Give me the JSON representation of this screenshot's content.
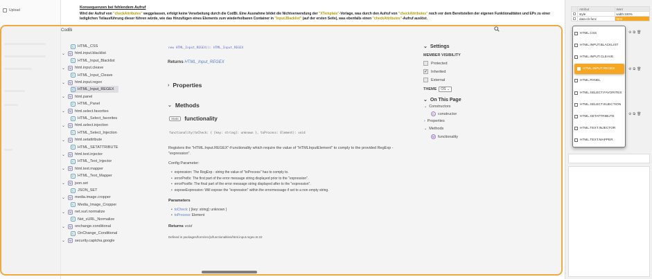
{
  "left_panel": {
    "upload_label": "Upload"
  },
  "doc": {
    "heading": "Konsequenzen bei fehlendem Aufruf",
    "para_1": "Wird der Aufruf von ",
    "para_hl_1": "\"checkAttributes\"",
    "para_2": " weggelassen, erfolgt keine Verarbeitung durch die CodBi. Eine Ausnahme bildet die Nichtverwendung der ",
    "para_hl_2": "\"XTemplate\"",
    "para_3": "-Vorlage, was durch den Aufruf von ",
    "para_hl_3": "\"checkAttributes\"",
    "para_4": " noch vor dem Bereitstellen der eigenen Funktionalitäten und EPs zu einer lediglichen Teilausführung dieser führen würde, wie das Hinzufügen eines Elements zum wiederholbaren Container in ",
    "para_hl_4": "\"Input.Blacklist\"",
    "para_5": " (auf der ersten Seite), was ebenfalls einen ",
    "para_hl_5": "\"checkAttributes\"",
    "para_6": "-Aufruf auslöst."
  },
  "attr_table": {
    "header": [
      "Attribut",
      "Wert"
    ],
    "rows": [
      {
        "name": "style",
        "value": "width:100%"
      },
      {
        "name": "data-cb-func",
        "value": "html"
      }
    ]
  },
  "modal": {
    "title": "CodBi",
    "tree": [
      {
        "label": "HTML_CSS",
        "kind": "class",
        "child": true,
        "top": 0
      },
      {
        "label": "html.input.blacklist",
        "kind": "module",
        "child": false
      },
      {
        "label": "HTML_Input_Blacklist",
        "kind": "class",
        "child": true
      },
      {
        "label": "html.input.cleave",
        "kind": "module",
        "child": false
      },
      {
        "label": "HTML_Input_Cleave",
        "kind": "class",
        "child": true
      },
      {
        "label": "html.input.regex",
        "kind": "module",
        "child": false
      },
      {
        "label": "HTML_Input_REGEX",
        "kind": "class",
        "child": true,
        "active": true
      },
      {
        "label": "html.panel",
        "kind": "module",
        "child": false
      },
      {
        "label": "HTML_Panel",
        "kind": "class",
        "child": true
      },
      {
        "label": "html.select.favorites",
        "kind": "module",
        "child": false
      },
      {
        "label": "HTML_Select_favorites",
        "kind": "class",
        "child": true
      },
      {
        "label": "html.select.injection",
        "kind": "module",
        "child": false
      },
      {
        "label": "HTML_Select_Injection",
        "kind": "class",
        "child": true
      },
      {
        "label": "html.setattribute",
        "kind": "module",
        "child": false
      },
      {
        "label": "HTML_SETATTRIBUTE",
        "kind": "class",
        "child": true
      },
      {
        "label": "html.text.injector",
        "kind": "module",
        "child": false
      },
      {
        "label": "HTML_Text_Injector",
        "kind": "class",
        "child": true
      },
      {
        "label": "html.text.mapper",
        "kind": "module",
        "child": false
      },
      {
        "label": "HTML_Text_Mapper",
        "kind": "class",
        "child": true
      },
      {
        "label": "json.set",
        "kind": "module",
        "child": false
      },
      {
        "label": "JSON_SET",
        "kind": "class",
        "child": true
      },
      {
        "label": "media.image.cropper",
        "kind": "module",
        "child": false
      },
      {
        "label": "Media_Image_Cropper",
        "kind": "class",
        "child": true
      },
      {
        "label": "net.xurl.normalize",
        "kind": "module",
        "child": false
      },
      {
        "label": "Net_xURL_Normalize",
        "kind": "class",
        "child": true
      },
      {
        "label": "onchange.conditional",
        "kind": "module",
        "child": false
      },
      {
        "label": "OnChange_Conditional",
        "kind": "class",
        "child": true
      },
      {
        "label": "security.captcha.google",
        "kind": "module",
        "child": false
      }
    ],
    "code_line": "new HTML_Input_REGEX(): HTML_Input_REGEX",
    "returns_label": "Returns",
    "returns_value": "HTML_Input_REGEX",
    "properties_h": "Properties",
    "methods_h": "Methods",
    "static_badge": "Static",
    "func_name": "functionality",
    "signature": "functionality(toCheck: { [key: string]: unknown }, toProcess: Element): void",
    "description": "Registers the \"HTML.Input.REGEX\"-Functionality which require the value of \"HTMLInputElement\" to comply to the provided RegExp - \"expression\".",
    "config_h": "Config Parameter:",
    "bullets": [
      "expression: The RegExp - string the value of \"toProcess\" has to comply to.",
      "errorPrefix: The first part of the error message string displayed prior to the \"expression\".",
      "errorPostfix: The final part of the error message string displayed after to the \"expression\".",
      "exposeExpression: Will expose the \"expression\" within the errormessage if set to a non empty string."
    ],
    "params_h": "Parameters",
    "params": [
      {
        "name": "toCheck",
        "type": ": { [key: string]: unknown }"
      },
      {
        "name": "toProcess",
        "type": ": Element"
      }
    ],
    "returns2_label": "Returns",
    "returns2_value": "void",
    "defined": "Defined in packages/form/src/js/functionalities/html.input.regex.ts:22",
    "settings": {
      "title": "Settings",
      "member_visibility": "MEMBER VISIBILITY",
      "checks": [
        {
          "label": "Protected",
          "checked": false
        },
        {
          "label": "Inherited",
          "checked": true
        },
        {
          "label": "External",
          "checked": false
        }
      ],
      "theme_label": "THEME",
      "theme_value": "OS"
    },
    "on_this_page": {
      "title": "On This Page",
      "items": [
        "Constructors",
        "constructor",
        "Properties",
        "Methods",
        "functionality"
      ]
    }
  },
  "dropdown": {
    "items": [
      "HTML.CSS",
      "HTML.INPUT.BLACKLIST",
      "HTML.INPUT.CLEAVE",
      "HTML.INPUT.REGEX",
      "HTML.PANEL",
      "HTML.SELECT.FAVORITES",
      "HTML.SELECT.INJECTION",
      "HTML.SETATTRIBUTE",
      "HTML.TEXT.INJECTOR",
      "HTML.TEXT.MAPPER"
    ],
    "active_index": 3
  },
  "colors": {
    "accent": "#f5a623",
    "link": "#5a7dc8",
    "overlay_border": "#f0a940"
  }
}
